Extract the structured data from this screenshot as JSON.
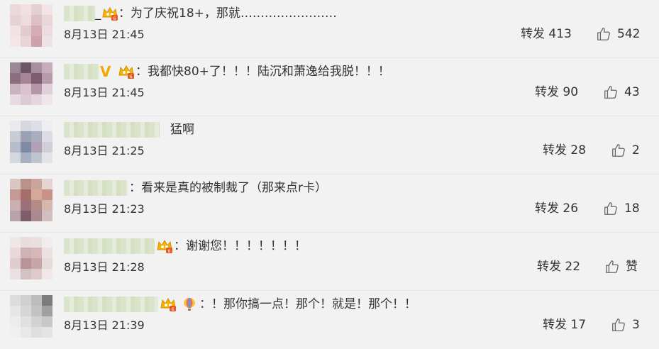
{
  "comments": [
    {
      "text": "：为了庆祝18+，那就……………………",
      "time": "8月13日 21:45",
      "repost": "转发 413",
      "likes": "542",
      "underscore": "_"
    },
    {
      "text": "：我都快80+了！！！陆沉和萧逸给我脱！！！",
      "time": "8月13日 21:45",
      "repost": "转发 90",
      "likes": "43"
    },
    {
      "text": "猛啊",
      "time": "8月13日 21:25",
      "repost": "转发 28",
      "likes": "2"
    },
    {
      "text": "：看来是真的被制裁了（那来点r卡）",
      "time": "8月13日 21:23",
      "repost": "转发 26",
      "likes": "18"
    },
    {
      "text": "：谢谢您！！！！！！！",
      "time": "8月13日 21:28",
      "repost": "转发 22",
      "likes": "赞"
    },
    {
      "text": "：！那你搞一点！那个！就是！那个！！",
      "time": "8月13日 21:39",
      "repost": "转发 17",
      "likes": "3"
    }
  ],
  "colors": {
    "background": "#f2f2f2",
    "text": "#333333",
    "vip_gold": "#f4a800",
    "fan_badge": "#e8a020"
  },
  "icons": [
    "crown-vip-icon",
    "v-verified-icon",
    "fan-badge-icon",
    "thumbs-up-icon",
    "hot-air-balloon-icon"
  ]
}
